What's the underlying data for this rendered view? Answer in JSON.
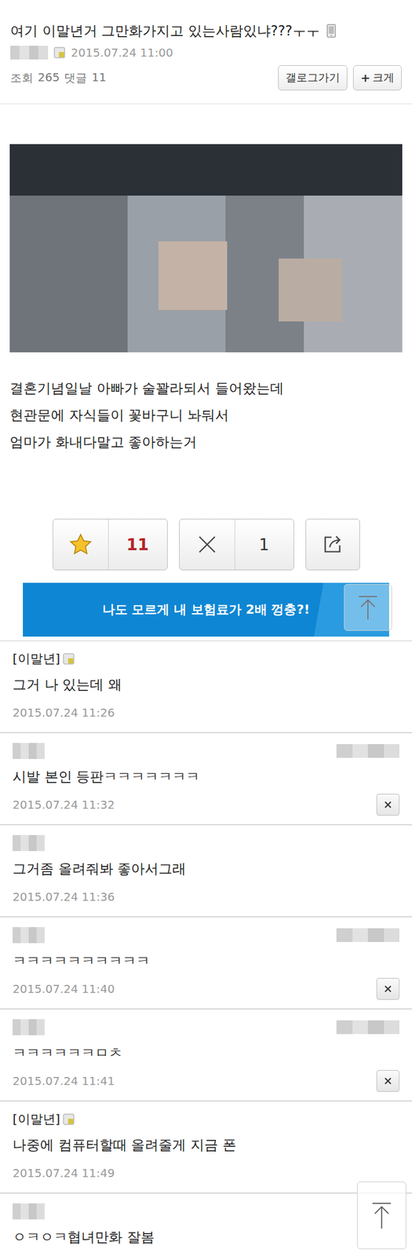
{
  "post": {
    "title": "여기 이말년거 그만화가지고 있는사람있냐???ㅜㅜ",
    "author_masked": true,
    "date": "2015.07.24 11:00",
    "views_label": "조회",
    "views": "265",
    "comments_label": "댓글",
    "comments_count": "11",
    "buttons": [
      {
        "icon": "",
        "label": "갤로그가기"
      },
      {
        "icon": "+",
        "label": "크게"
      }
    ],
    "body": [
      "결혼기념일날 아빠가 술꽐라되서 들어왔는데",
      "현관문에 자식들이 꽃바구니 놔둬서",
      "엄마가 화내다말고 좋아하는거"
    ]
  },
  "votes": {
    "up": "11",
    "down": "1"
  },
  "ad": {
    "text": "나도 모르게 내 보험료가 2배 껑충?!"
  },
  "comments": [
    {
      "author": "[이말년]",
      "masked": false,
      "text": "그거 나 있는데 왜",
      "date": "2015.07.24 11:26",
      "deletable": false
    },
    {
      "author": "",
      "masked": true,
      "text": "시발 본인 등판ㅋㅋㅋㅋㅋㅋㅋ",
      "date": "2015.07.24 11:32",
      "deletable": true
    },
    {
      "author": "",
      "masked": true,
      "text": "그거좀 올려줘봐 좋아서그래",
      "date": "2015.07.24 11:36",
      "deletable": false
    },
    {
      "author": "",
      "masked": true,
      "text": "ㅋㅋㅋㅋㅋㅋㅋㅋㅋㅋ",
      "date": "2015.07.24 11:40",
      "deletable": true
    },
    {
      "author": "",
      "masked": true,
      "text": "ㅋㅋㅋㅋㅋㅋㅁㅊ",
      "date": "2015.07.24 11:41",
      "deletable": true
    },
    {
      "author": "[이말년]",
      "masked": false,
      "text": "나중에 컴퓨터할때 올려줄게 지금 폰",
      "date": "2015.07.24 11:49",
      "deletable": false
    },
    {
      "author": "",
      "masked": true,
      "text": "ㅇㅋㅇㅋ협녀만화 잘봄",
      "date": "",
      "deletable": false
    }
  ]
}
